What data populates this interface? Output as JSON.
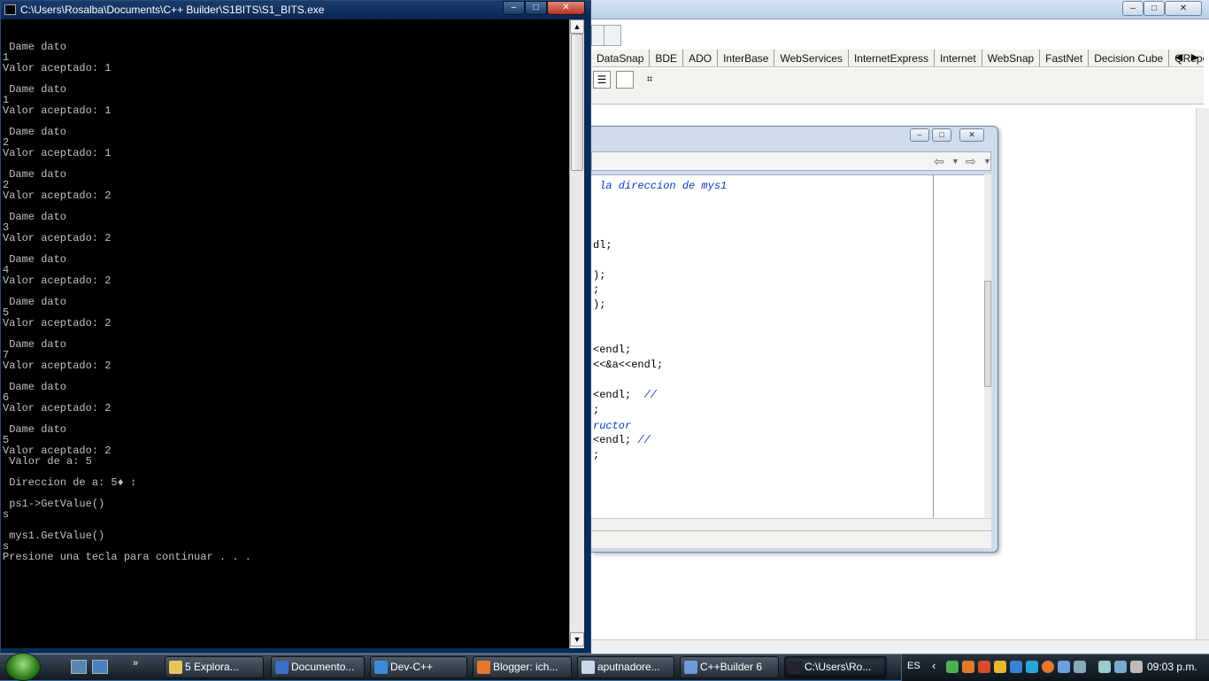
{
  "console": {
    "title": "C:\\Users\\Rosalba\\Documents\\C++ Builder\\S1BITS\\S1_BITS.exe",
    "lines": [
      " Dame dato",
      "1",
      "Valor aceptado: 1",
      " Dame dato",
      "1",
      "Valor aceptado: 1",
      " Dame dato",
      "2",
      "Valor aceptado: 1",
      " Dame dato",
      "2",
      "Valor aceptado: 2",
      " Dame dato",
      "3",
      "Valor aceptado: 2",
      " Dame dato",
      "4",
      "Valor aceptado: 2",
      " Dame dato",
      "5",
      "Valor aceptado: 2",
      " Dame dato",
      "7",
      "Valor aceptado: 2",
      " Dame dato",
      "6",
      "Valor aceptado: 2",
      " Dame dato",
      "5",
      "Valor aceptado: 2",
      " Valor de a: 5",
      " Direccion de a: 5♦ ↕",
      " ps1->GetValue()",
      "s",
      " mys1.GetValue()",
      "s",
      "Presione una tecla para continuar . . ."
    ]
  },
  "palette": {
    "tabs": [
      "DataSnap",
      "BDE",
      "ADO",
      "InterBase",
      "WebServices",
      "InternetExpress",
      "Internet",
      "WebSnap",
      "FastNet",
      "Decision Cube",
      "QReport"
    ]
  },
  "editor": {
    "code_lines": [
      {
        "text": " la direccion de mys1",
        "comment": true
      },
      {
        "text": "dl;",
        "comment": false
      },
      {
        "text": ");",
        "comment": false
      },
      {
        "text": ";",
        "comment": false
      },
      {
        "text": ");",
        "comment": false
      },
      {
        "text": "<endl;",
        "comment": false
      },
      {
        "text": "<<&a<<endl;",
        "comment": false
      },
      {
        "text": "<endl;  ",
        "comment": false,
        "tail": "//"
      },
      {
        "text": ";",
        "comment": false
      },
      {
        "text": "ructor",
        "comment": true
      },
      {
        "text": "<endl; ",
        "comment": false,
        "tail": "//"
      },
      {
        "text": ";",
        "comment": false
      }
    ]
  },
  "taskbar": {
    "buttons": [
      {
        "label": "5 Explora...",
        "icon": "folder-icon",
        "color": "#e8c45a"
      },
      {
        "label": "Documento...",
        "icon": "word-icon",
        "color": "#3a6fc4"
      },
      {
        "label": "Dev-C++",
        "icon": "devcpp-icon",
        "color": "#3c8ad8"
      },
      {
        "label": "Blogger: ich...",
        "icon": "firefox-icon",
        "color": "#e8772e"
      },
      {
        "label": "aputnadore...",
        "icon": "notepad-icon",
        "color": "#c9d9ea"
      },
      {
        "label": "C++Builder 6",
        "icon": "cppbuilder-icon",
        "color": "#6b9bd8"
      },
      {
        "label": "C:\\Users\\Ro...",
        "icon": "console-icon",
        "color": "#223"
      }
    ],
    "tray": {
      "language": "ES",
      "clock": "09:03 p.m."
    }
  }
}
